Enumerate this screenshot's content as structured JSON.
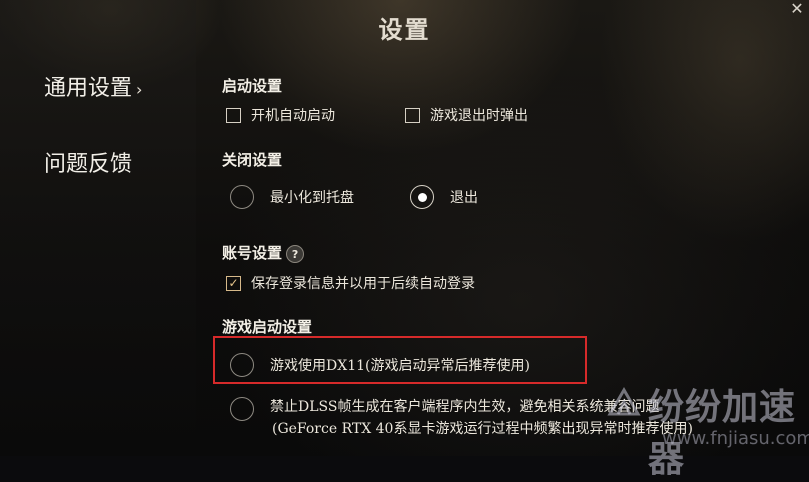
{
  "window": {
    "title": "设置",
    "close_label": "✕"
  },
  "sidebar": {
    "items": [
      {
        "label": "通用设置",
        "active": true,
        "chevron": "›"
      },
      {
        "label": "问题反馈",
        "active": false
      }
    ]
  },
  "sections": {
    "startup": {
      "heading": "启动设置",
      "options": [
        {
          "label": "开机自动启动",
          "checked": false
        },
        {
          "label": "游戏退出时弹出",
          "checked": false
        }
      ]
    },
    "close": {
      "heading": "关闭设置",
      "options": [
        {
          "label": "最小化到托盘",
          "selected": false
        },
        {
          "label": "退出",
          "selected": true
        }
      ]
    },
    "account": {
      "heading": "账号设置",
      "help": "?",
      "options": [
        {
          "label": "保存登录信息并以用于后续自动登录",
          "checked": true
        }
      ]
    },
    "game_launch": {
      "heading": "游戏启动设置",
      "options": [
        {
          "label": "游戏使用DX11(游戏启动异常后推荐使用)",
          "selected": false
        },
        {
          "label": "禁止DLSS帧生成在客户端程序内生效，避免相关系统兼容问题",
          "label2": "(GeForce RTX 40系显卡游戏运行过程中频繁出现异常时推荐使用)",
          "selected": false
        }
      ]
    }
  },
  "watermark": {
    "text": "纷纷加速器",
    "url": "www.fnjiasu.com"
  },
  "colors": {
    "highlight": "#d62a2a",
    "accent": "#e7c58c"
  }
}
